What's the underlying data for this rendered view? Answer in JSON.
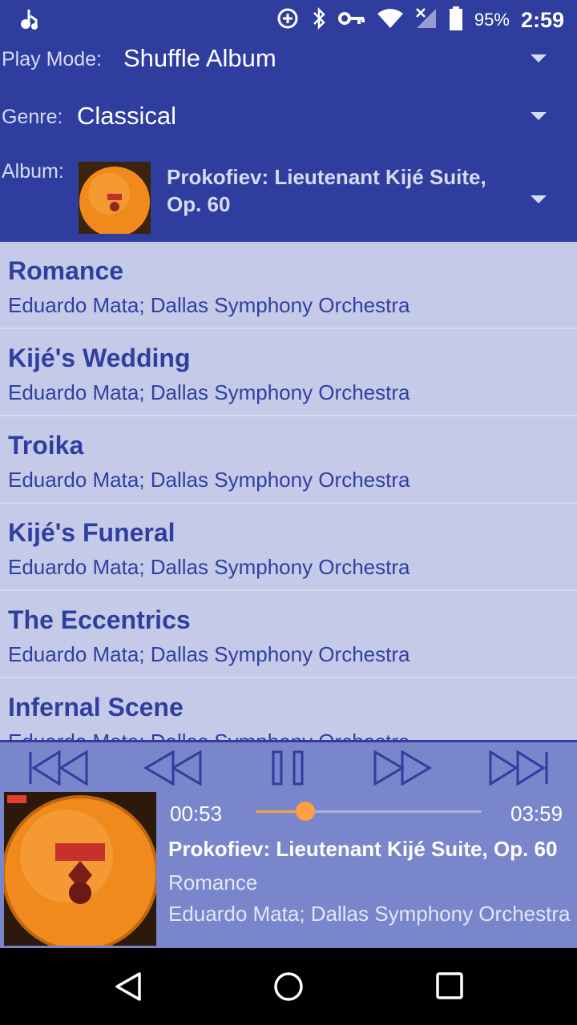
{
  "status_bar": {
    "battery_percent": "95%",
    "time": "2:59",
    "icons": [
      "app-music-icon",
      "data-saver-icon",
      "bluetooth-icon",
      "vpn-key-icon",
      "wifi-icon",
      "signal-icon",
      "battery-icon"
    ]
  },
  "header": {
    "play_mode_label": "Play Mode:",
    "play_mode_value": "Shuffle Album",
    "genre_label": "Genre:",
    "genre_value": "Classical",
    "album_label": "Album:",
    "album_value": "Prokofiev: Lieutenant Kijé Suite, Op. 60"
  },
  "tracks": [
    {
      "title": "Romance",
      "artist": "Eduardo Mata; Dallas Symphony Orchestra"
    },
    {
      "title": "Kijé's Wedding",
      "artist": "Eduardo Mata; Dallas Symphony Orchestra"
    },
    {
      "title": "Troika",
      "artist": "Eduardo Mata; Dallas Symphony Orchestra"
    },
    {
      "title": "Kijé's Funeral",
      "artist": "Eduardo Mata; Dallas Symphony Orchestra"
    },
    {
      "title": "The Eccentrics",
      "artist": "Eduardo Mata; Dallas Symphony Orchestra"
    },
    {
      "title": "Infernal Scene",
      "artist": "Eduardo Mata; Dallas Symphony Orchestra"
    }
  ],
  "player": {
    "elapsed": "00:53",
    "duration": "03:59",
    "progress": 0.22,
    "album": "Prokofiev: Lieutenant Kijé Suite, Op. 60",
    "track": "Romance",
    "artist": "Eduardo Mata; Dallas Symphony Orchestra",
    "controls": [
      "skip-previous-icon",
      "rewind-icon",
      "pause-icon",
      "fast-forward-icon",
      "skip-next-icon"
    ]
  },
  "colors": {
    "primary": "#2f3d9e",
    "list_background": "#c5cae9",
    "player_background": "#7986cb",
    "accent": "#ffa040"
  }
}
